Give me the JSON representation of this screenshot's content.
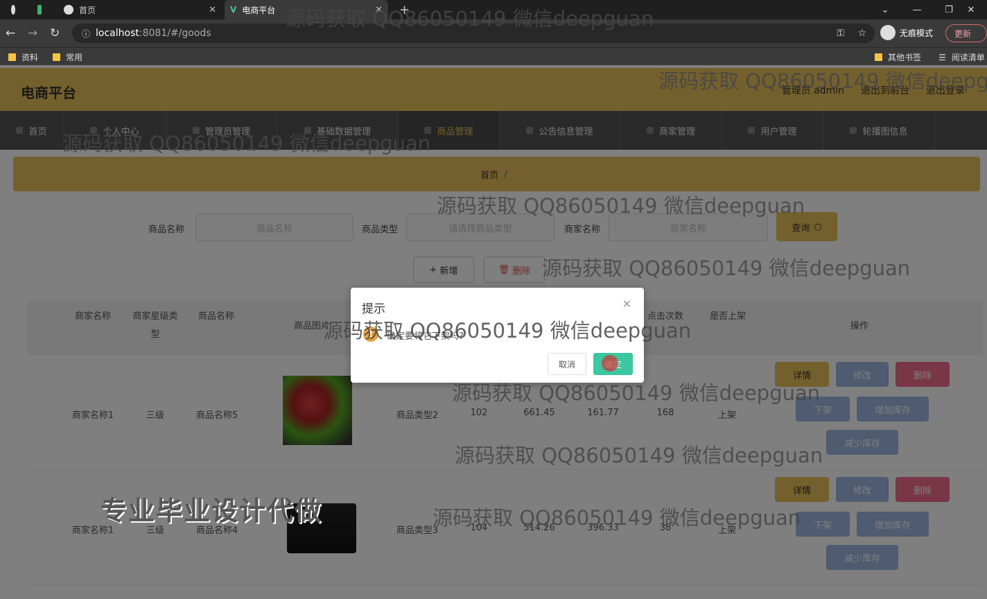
{
  "browser": {
    "tabs": [
      {
        "label": ""
      },
      {
        "label": ""
      },
      {
        "label": "首页"
      },
      {
        "label": "电商平台"
      }
    ],
    "url_host": "localhost",
    "url_path": ":8081/#/goods",
    "incognito_label": "无痕模式",
    "update_label": "更新",
    "bookmarks": [
      "资料",
      "常用"
    ],
    "bookmarks_right": [
      "其他书签",
      "阅读清单"
    ]
  },
  "header": {
    "logo": "电商平台",
    "user": "管理员 admin",
    "to_front": "退出到前台",
    "logout": "退出登录"
  },
  "menu": [
    {
      "label": "首页"
    },
    {
      "label": "个人中心"
    },
    {
      "label": "管理员管理"
    },
    {
      "label": "基础数据管理"
    },
    {
      "label": "商品管理"
    },
    {
      "label": "公告信息管理"
    },
    {
      "label": "商家管理"
    },
    {
      "label": "用户管理"
    },
    {
      "label": "轮播图信息"
    }
  ],
  "breadcrumb": {
    "home": "首页",
    "sep": "/",
    "current": ""
  },
  "search": {
    "goods_name_label": "商品名称",
    "goods_name_placeholder": "商品名称",
    "goods_type_label": "商品类型",
    "goods_type_placeholder": "请选择商品类型",
    "merchant_label": "商家名称",
    "merchant_placeholder": "商家名称",
    "query_button": "查询"
  },
  "actions": {
    "add": "新增",
    "delete": "删除"
  },
  "table": {
    "headers": [
      "商家名称",
      "商家星级类型",
      "商品名称",
      "商品图片",
      "点击次数",
      "是否上架",
      "操作"
    ],
    "rows": [
      {
        "merchant": "商家名称1",
        "star": "三级",
        "name": "商品名称5",
        "type": "商品类型2",
        "stock": "102",
        "price_old": "661.45",
        "price_new": "161.77",
        "clicks": "168",
        "status": "上架"
      },
      {
        "merchant": "商家名称1",
        "star": "三级",
        "name": "商品名称4",
        "type": "商品类型3",
        "stock": "104",
        "price_old": "514.26",
        "price_new": "396.33",
        "clicks": "38",
        "status": "上架"
      }
    ],
    "ops": {
      "detail": "详情",
      "edit": "修改",
      "delete": "删除",
      "down": "下架",
      "add_stock": "增加库存",
      "reduce_stock": "减少库存"
    }
  },
  "dialog": {
    "title": "提示",
    "message": "确定要将它下架吗?",
    "cancel": "取消",
    "ok": "确定"
  },
  "watermarks": {
    "qq": "源码获取 QQ86050149 微信deepguan",
    "banner": "专业毕业设计代做"
  }
}
